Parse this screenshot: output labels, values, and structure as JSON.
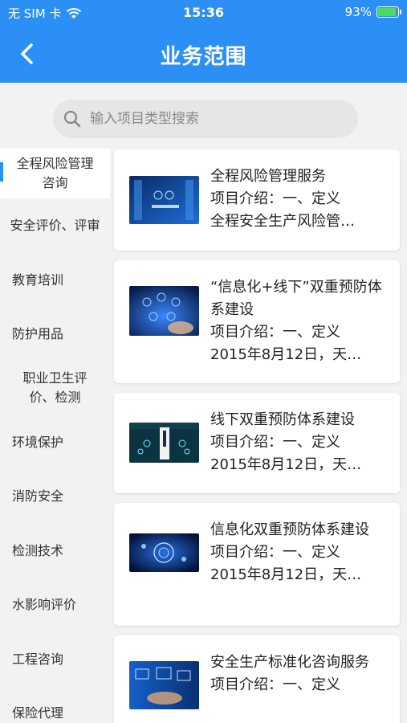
{
  "status_bar": {
    "carrier": "无 SIM 卡",
    "time": "15:36",
    "battery": "93%"
  },
  "header": {
    "title": "业务范围"
  },
  "search": {
    "placeholder": "输入项目类型搜索"
  },
  "sidebar": {
    "items": [
      {
        "label": "全程风险管理咨询",
        "active": true
      },
      {
        "label": "安全评价、评审"
      },
      {
        "label": "教育培训"
      },
      {
        "label": "防护用品"
      },
      {
        "label": "职业卫生评价、检测"
      },
      {
        "label": "环境保护"
      },
      {
        "label": "消防安全"
      },
      {
        "label": "检测技术"
      },
      {
        "label": "水影响评价"
      },
      {
        "label": "工程咨询"
      },
      {
        "label": "保险代理"
      }
    ]
  },
  "cards": [
    {
      "title": "全程风险管理服务",
      "intro": "项目介绍：一、定义",
      "desc": "全程安全生产风险管…"
    },
    {
      "title": "“信息化+线下”双重预防体系建设",
      "intro": "项目介绍：一、定义",
      "desc": "2015年8月12日，天…"
    },
    {
      "title": "线下双重预防体系建设",
      "intro": "项目介绍：一、定义",
      "desc": "2015年8月12日，天…"
    },
    {
      "title": "信息化双重预防体系建设",
      "intro": "项目介绍：一、定义",
      "desc": "2015年8月12日，天…"
    },
    {
      "title": "安全生产标准化咨询服务",
      "intro": "项目介绍：一、定义",
      "desc": ""
    }
  ],
  "colors": {
    "primary": "#2b8ff5",
    "battery": "#4cd964"
  }
}
